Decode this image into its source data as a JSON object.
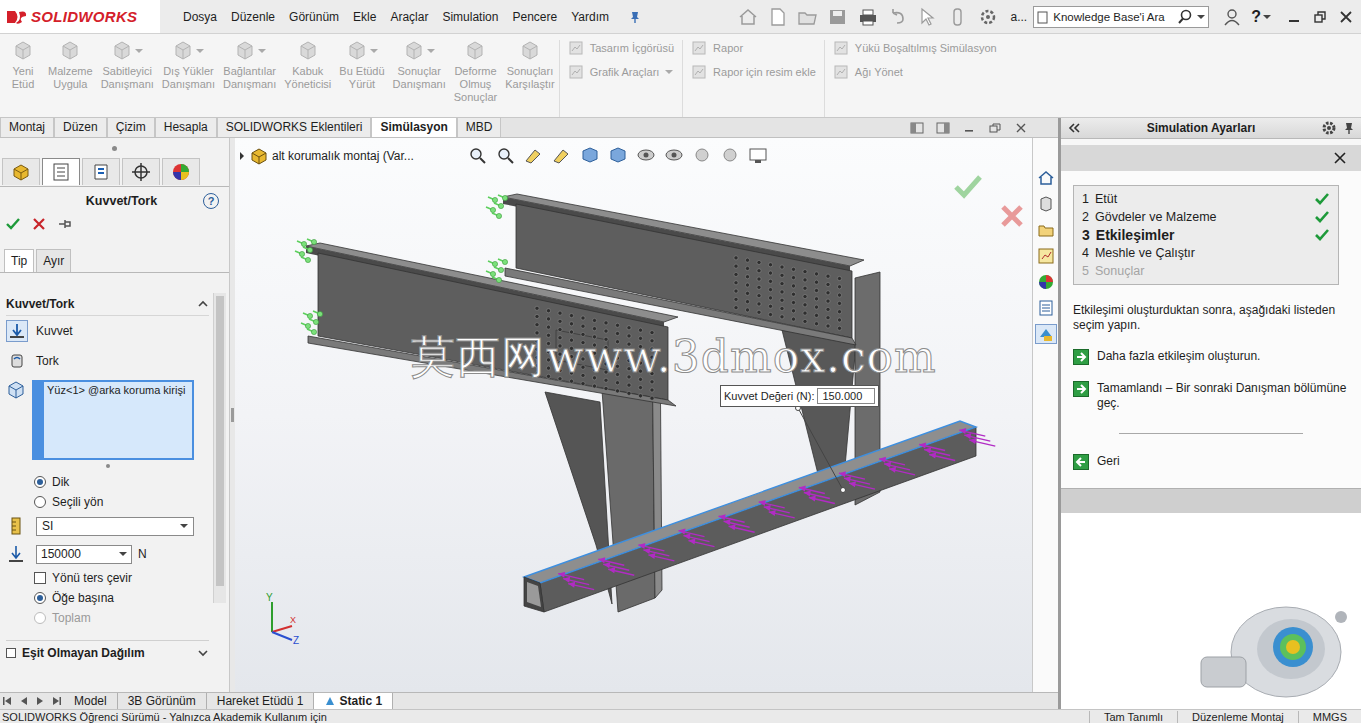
{
  "titlebar": {
    "brand": "SOLIDWORKS",
    "menu": [
      "Dosya",
      "Düzenle",
      "Görünüm",
      "Ekle",
      "Araçlar",
      "Simulation",
      "Pencere",
      "Yardım"
    ],
    "user_short": "a...",
    "search": {
      "placeholder": "Knowledge Base'i Ara"
    },
    "help": "?"
  },
  "ribbon": {
    "large": [
      {
        "lines": [
          "Yeni",
          "Etüd"
        ],
        "disabled": true,
        "dropdown": false
      },
      {
        "lines": [
          "Malzeme",
          "Uygula"
        ],
        "disabled": true,
        "dropdown": false
      },
      {
        "lines": [
          "Sabitleyici",
          "Danışmanı"
        ],
        "disabled": true,
        "dropdown": true
      },
      {
        "lines": [
          "Dış Yükler",
          "Danışmanı"
        ],
        "disabled": true,
        "dropdown": true
      },
      {
        "lines": [
          "Bağlantılar",
          "Danışmanı"
        ],
        "disabled": true,
        "dropdown": true
      },
      {
        "lines": [
          "Kabuk",
          "Yöneticisi"
        ],
        "disabled": true,
        "dropdown": false
      },
      {
        "lines": [
          "Bu Etüdü",
          "Yürüt"
        ],
        "disabled": true,
        "dropdown": true
      },
      {
        "lines": [
          "Sonuçlar",
          "Danışmanı"
        ],
        "disabled": true,
        "dropdown": true
      },
      {
        "lines": [
          "Deforme",
          "Olmuş",
          "Sonuçlar"
        ],
        "disabled": true,
        "dropdown": false
      },
      {
        "lines": [
          "Sonuçları",
          "Karşılaştır"
        ],
        "disabled": true,
        "dropdown": false
      }
    ],
    "small_groups": [
      {
        "items": [
          {
            "label": "Tasarım İçgörüsü",
            "disabled": true,
            "dropdown": false
          },
          {
            "label": "Grafik Araçları",
            "disabled": true,
            "dropdown": true
          }
        ]
      },
      {
        "items": [
          {
            "label": "Rapor",
            "disabled": true,
            "dropdown": false
          },
          {
            "label": "Rapor için resim ekle",
            "disabled": true,
            "dropdown": false
          }
        ]
      },
      {
        "items": [
          {
            "label": "Yükü Boşaltılmış Simülasyon",
            "disabled": true,
            "dropdown": false
          },
          {
            "label": "Ağı Yönet",
            "disabled": true,
            "dropdown": false
          }
        ]
      }
    ]
  },
  "command_tabs": [
    {
      "label": "Montaj",
      "selected": false
    },
    {
      "label": "Düzen",
      "selected": false
    },
    {
      "label": "Çizim",
      "selected": false
    },
    {
      "label": "Hesapla",
      "selected": false
    },
    {
      "label": "SOLIDWORKS Eklentileri",
      "selected": false
    },
    {
      "label": "Simülasyon",
      "selected": true
    },
    {
      "label": "MBD",
      "selected": false
    }
  ],
  "property_manager": {
    "icon_tabs": [
      {
        "selected": false
      },
      {
        "selected": true
      },
      {
        "selected": false
      },
      {
        "selected": false
      },
      {
        "selected": false
      }
    ],
    "title": "Kuvvet/Tork",
    "help": "?",
    "sub_tabs": [
      {
        "label": "Tip",
        "selected": true
      },
      {
        "label": "Ayır",
        "selected": false
      }
    ],
    "section": {
      "title": "Kuvvet/Tork",
      "expanded": true
    },
    "types": [
      {
        "label": "Kuvvet",
        "selected": true
      },
      {
        "label": "Tork",
        "selected": false
      }
    ],
    "selection": [
      "Yüz<1> @arka koruma kirişi"
    ],
    "directions": [
      {
        "label": "Dik",
        "selected": true
      },
      {
        "label": "Seçili yön",
        "selected": false
      }
    ],
    "unit_system": "SI",
    "force_value": "150000",
    "force_unit": "N",
    "reverse": {
      "label": "Yönü ters çevir",
      "checked": false
    },
    "distribution": [
      {
        "label": "Öğe başına",
        "selected": true,
        "disabled": false
      },
      {
        "label": "Toplam",
        "selected": false,
        "disabled": true
      }
    ],
    "next_section": {
      "title": "Eşit Olmayan Dağılım",
      "expanded": false
    }
  },
  "viewport": {
    "tree_label": "alt korumalık montaj  (Var...",
    "watermark": "莫西网www.3dmox.com",
    "callout": {
      "label": "Kuvvet Değeri (N):",
      "value": "150.000"
    },
    "axes": [
      {
        "label": "Y",
        "color": "#2e9e2e"
      },
      {
        "label": "X",
        "color": "#d23030"
      },
      {
        "label": "Z",
        "color": "#2a4fd0"
      }
    ]
  },
  "task_tabs": [
    {
      "selected": false
    },
    {
      "selected": false
    },
    {
      "selected": false
    },
    {
      "selected": false
    },
    {
      "selected": false
    },
    {
      "selected": false
    },
    {
      "selected": true
    }
  ],
  "bottom_tabs": [
    {
      "label": "Model",
      "selected": false
    },
    {
      "label": "3B Görünüm",
      "selected": false
    },
    {
      "label": "Hareket Etüdü 1",
      "selected": false
    },
    {
      "label": "Static 1",
      "selected": true
    }
  ],
  "task_pane": {
    "title": "Simulation Ayarları",
    "steps": [
      {
        "number": "1",
        "label": "Etüt",
        "done": true,
        "current": false,
        "disabled": false
      },
      {
        "number": "2",
        "label": "Gövdeler ve Malzeme",
        "done": true,
        "current": false,
        "disabled": false
      },
      {
        "number": "3",
        "label": "Etkileşimler",
        "done": true,
        "current": true,
        "disabled": false
      },
      {
        "number": "4",
        "label": "Meshle ve Çalıştır",
        "done": false,
        "current": false,
        "disabled": false
      },
      {
        "number": "5",
        "label": "Sonuçlar",
        "done": false,
        "current": false,
        "disabled": true
      }
    ],
    "instruction": "Etkileşimi oluşturduktan sonra, aşağıdaki listeden seçim yapın.",
    "actions": [
      {
        "label": "Daha fazla etkileşim oluşturun.",
        "kind": "forward"
      },
      {
        "label": "Tamamlandı – Bir sonraki Danışman bölümüne geç.",
        "kind": "forward"
      },
      {
        "label": "Geri",
        "kind": "back"
      }
    ]
  },
  "status_bar": {
    "left": "SOLIDWORKS Öğrenci Sürümü - Yalnızca Akademik Kullanım için",
    "right": [
      "Tam Tanımlı",
      "Düzenleme Montaj",
      "MMGS"
    ]
  }
}
